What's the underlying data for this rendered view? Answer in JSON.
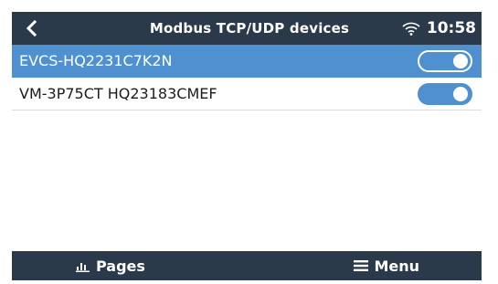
{
  "header": {
    "title": "Modbus TCP/UDP devices",
    "time": "10:58",
    "back_icon": "chevron-left-icon",
    "wifi_icon": "wifi-icon"
  },
  "devices": [
    {
      "label": "EVCS-HQ2231C7K2N",
      "enabled": true,
      "selected": true
    },
    {
      "label": "VM-3P75CT HQ23183CMEF",
      "enabled": true,
      "selected": false
    }
  ],
  "footer": {
    "pages_label": "Pages",
    "pages_icon": "bar-chart-icon",
    "menu_label": "Menu",
    "menu_icon": "hamburger-icon"
  },
  "colors": {
    "bar_background": "#2b3a4a",
    "accent": "#4f90d0",
    "divider": "#d6dde4"
  }
}
